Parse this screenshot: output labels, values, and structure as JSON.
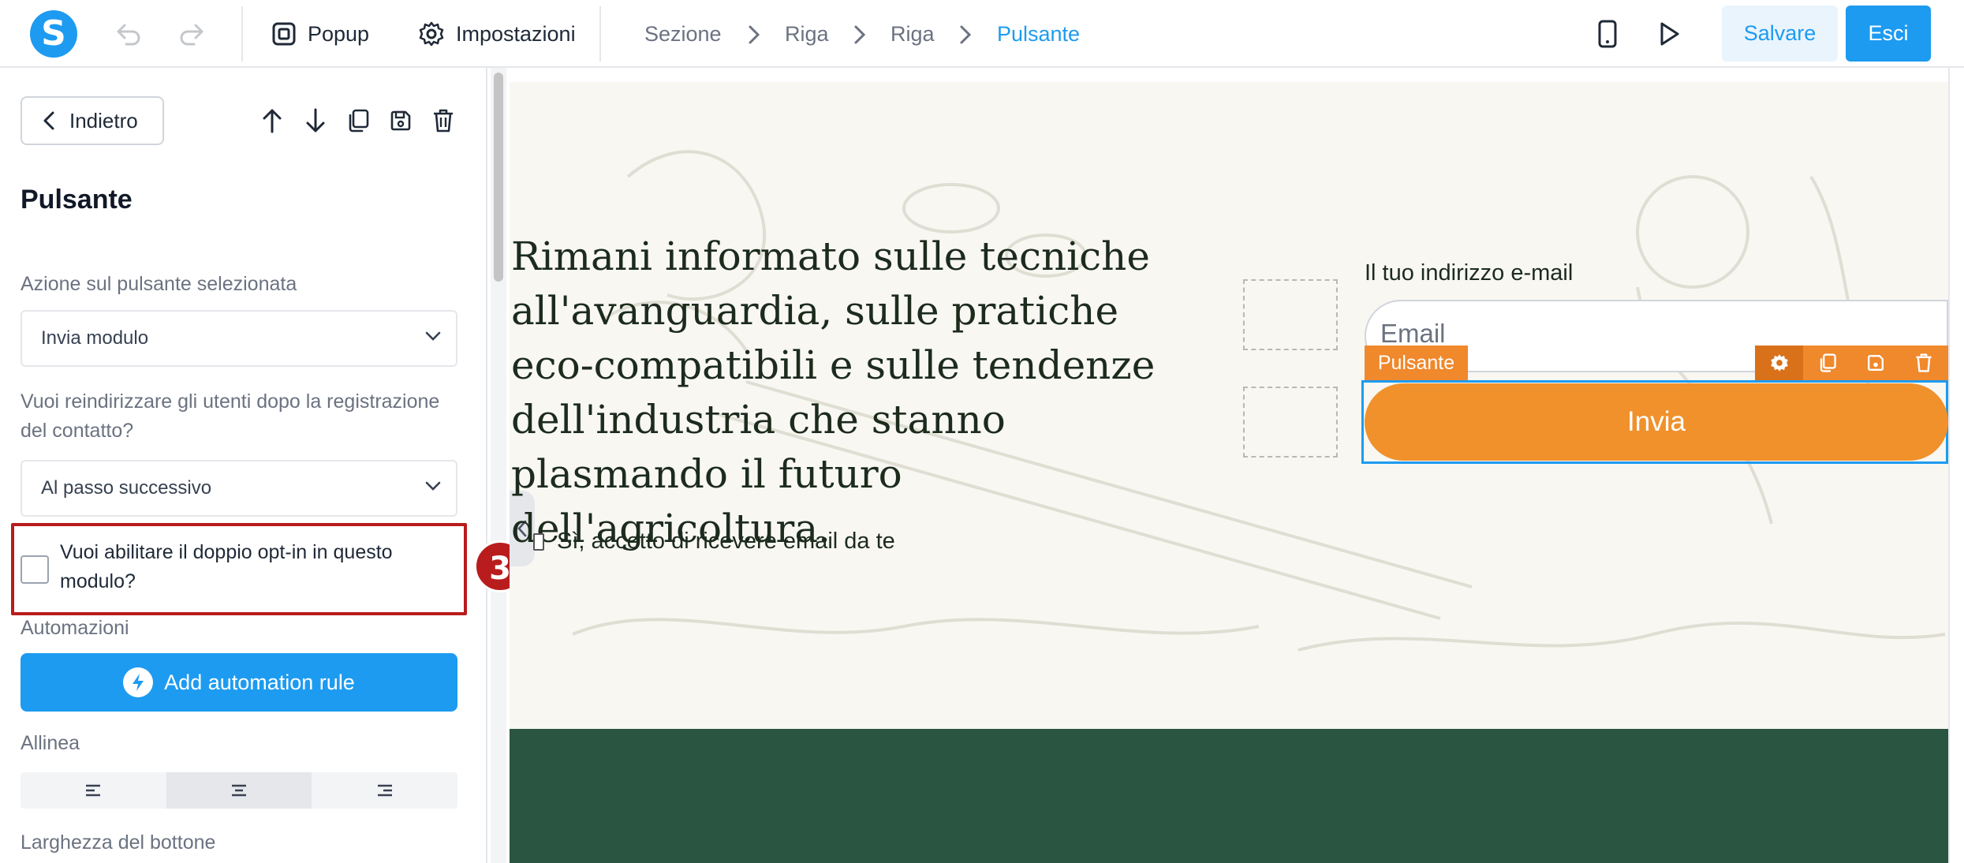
{
  "topbar": {
    "logo_letter": "S",
    "popup_label": "Popup",
    "settings_label": "Impostazioni",
    "breadcrumb": [
      "Sezione",
      "Riga",
      "Riga",
      "Pulsante"
    ],
    "save_label": "Salvare",
    "exit_label": "Esci"
  },
  "sidebar": {
    "back_label": "Indietro",
    "title": "Pulsante",
    "action_label": "Azione sul pulsante selezionata",
    "action_value": "Invia modulo",
    "redirect_label": "Vuoi reindirizzare gli utenti dopo la registrazione del contatto?",
    "redirect_value": "Al passo successivo",
    "double_optin_label": "Vuoi abilitare il doppio opt-in in questo modulo?",
    "double_optin_checked": false,
    "automations_label": "Automazioni",
    "add_automation_label": "Add automation rule",
    "align_label": "Allinea",
    "align_selected": "center",
    "width_label": "Larghezza del bottone"
  },
  "annotation": {
    "badge_number": "3"
  },
  "canvas": {
    "headline": "Rimani informato sulle tecniche all'avanguardia, sulle pratiche eco-compatibili e sulle tendenze dell'industria che stanno plasmando il futuro dell'agricoltura.",
    "consent_label": "Sì, accetto di ricevere email da te",
    "email_label": "Il tuo indirizzo e-mail",
    "email_placeholder": "Email",
    "selected_tag": "Pulsante",
    "submit_label": "Invia"
  },
  "colors": {
    "accent": "#1d9bf0",
    "highlight": "#b91c1c",
    "button_orange": "#f0912c",
    "dark_band": "#2a5540",
    "canvas_bg": "#f8f7f2"
  },
  "icons": [
    "undo-icon",
    "redo-icon",
    "popup-icon",
    "gear-icon",
    "mobile-icon",
    "play-icon",
    "chevron-left-icon",
    "arrow-up-icon",
    "arrow-down-icon",
    "copy-icon",
    "save-icon",
    "trash-icon",
    "chevron-down-icon",
    "bolt-icon",
    "align-left-icon",
    "align-center-icon",
    "align-right-icon"
  ]
}
